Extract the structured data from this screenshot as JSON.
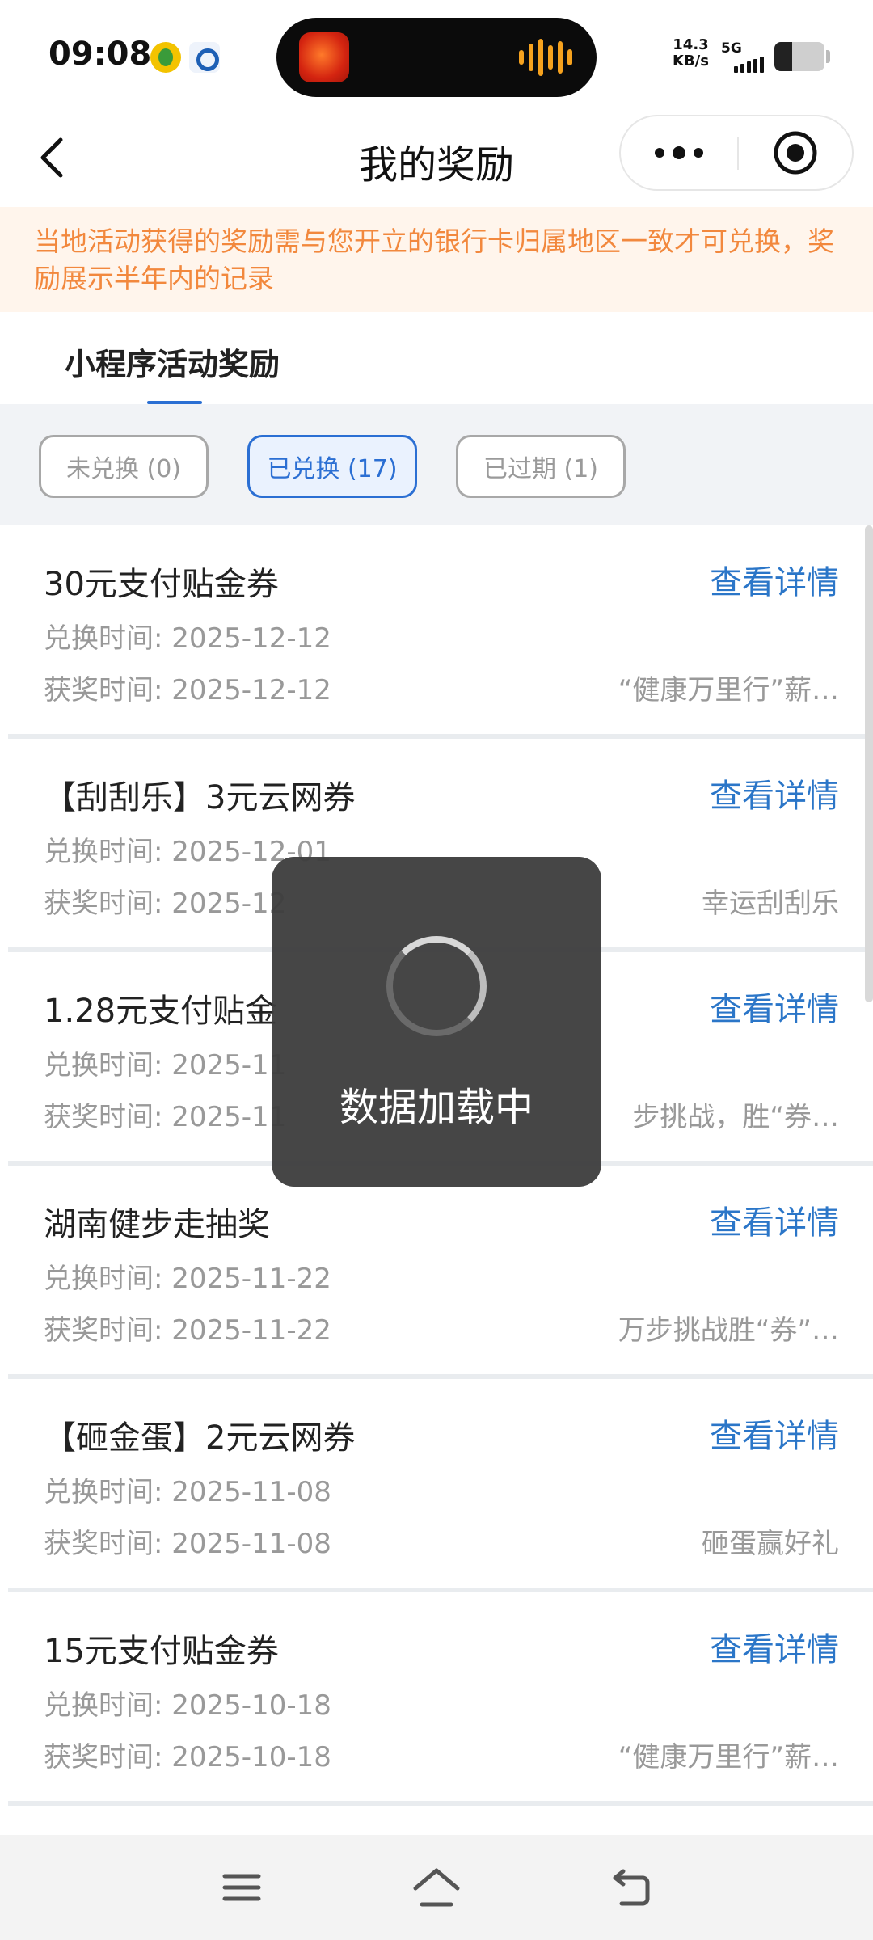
{
  "status_bar": {
    "time": "09:08",
    "net_speed_value": "14.3",
    "net_speed_unit": "KB/s",
    "network_type": "5G",
    "battery_level": 0.35,
    "icons": [
      "qq-music-icon",
      "baidu-icon",
      "app-live-icon",
      "audio-wave-icon",
      "signal-icon",
      "battery-icon"
    ]
  },
  "nav": {
    "back_icon": "chevron-left-icon",
    "title": "我的奖励",
    "more_icon": "more-dots-icon",
    "close_icon": "target-close-icon"
  },
  "notice": {
    "text": "当地活动获得的奖励需与您开立的银行卡归属地区一致才可兑换，奖励展示半年内的记录",
    "color": "#f2883d",
    "background": "#fff5ec"
  },
  "tab": {
    "label": "小程序活动奖励",
    "accent": "#2b6fd3"
  },
  "filters": [
    {
      "label": "未兑换 (0)",
      "active": false
    },
    {
      "label": "已兑换 (17)",
      "active": true
    },
    {
      "label": "已过期 (1)",
      "active": false
    }
  ],
  "rewards": [
    {
      "title": "30元支付贴金券",
      "link": "查看详情",
      "redeem_time": "兑换时间: 2025-12-12",
      "award_time": "获奖时间: 2025-12-12",
      "source": "“健康万里行”薪…"
    },
    {
      "title": "【刮刮乐】3元云网券",
      "link": "查看详情",
      "redeem_time": "兑换时间: 2025-12-01",
      "award_time": "获奖时间: 2025-12",
      "source": "幸运刮刮乐"
    },
    {
      "title": "1.28元支付贴金",
      "link": "查看详情",
      "redeem_time": "兑换时间: 2025-11",
      "award_time": "获奖时间: 2025-11",
      "source": "步挑战，胜“券…"
    },
    {
      "title": "湖南健步走抽奖",
      "link": "查看详情",
      "redeem_time": "兑换时间: 2025-11-22",
      "award_time": "获奖时间: 2025-11-22",
      "source": "万步挑战胜“券”…"
    },
    {
      "title": "【砸金蛋】2元云网券",
      "link": "查看详情",
      "redeem_time": "兑换时间: 2025-11-08",
      "award_time": "获奖时间: 2025-11-08",
      "source": "砸蛋赢好礼"
    },
    {
      "title": "15元支付贴金券",
      "link": "查看详情",
      "redeem_time": "兑换时间: 2025-10-18",
      "award_time": "获奖时间: 2025-10-18",
      "source": "“健康万里行”薪…"
    }
  ],
  "toast": {
    "text": "数据加载中",
    "icon": "loading-spinner-icon"
  },
  "bottom_nav": {
    "icons": [
      "menu-icon",
      "home-icon",
      "back-arrow-icon"
    ]
  }
}
